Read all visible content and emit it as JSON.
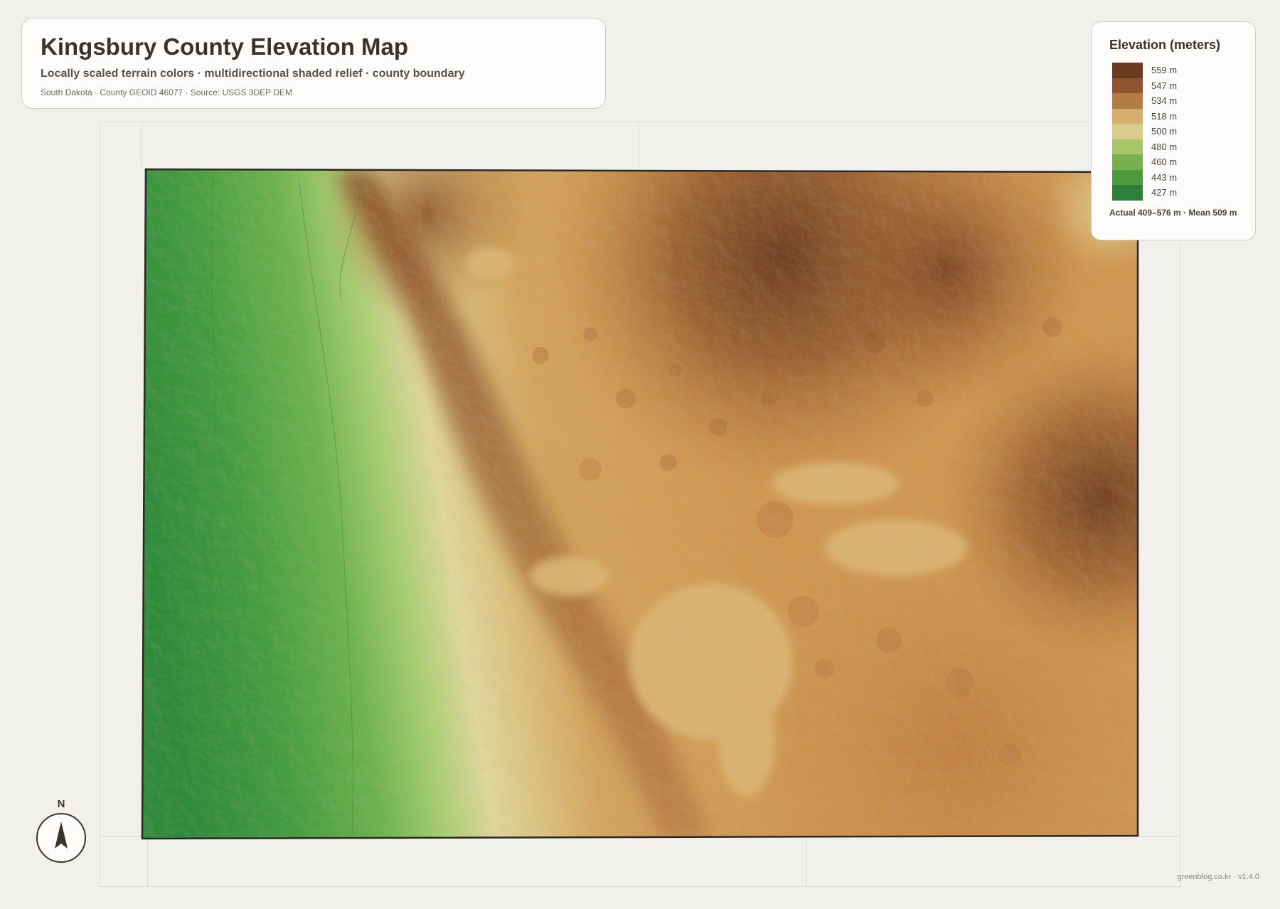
{
  "title_card": {
    "title": "Kingsbury County Elevation Map",
    "subtitle": "Locally scaled terrain colors · multidirectional shaded relief · county boundary",
    "source": "South Dakota · County GEOID 46077 · Source: USGS 3DEP DEM"
  },
  "legend": {
    "title": "Elevation (meters)",
    "items": [
      {
        "label": "559 m",
        "color": "#6a3a21"
      },
      {
        "label": "547 m",
        "color": "#8e5530"
      },
      {
        "label": "534 m",
        "color": "#b47c45"
      },
      {
        "label": "518 m",
        "color": "#d6ae6c"
      },
      {
        "label": "500 m",
        "color": "#d8cb8b"
      },
      {
        "label": "480 m",
        "color": "#a9c56a"
      },
      {
        "label": "460 m",
        "color": "#77b04d"
      },
      {
        "label": "443 m",
        "color": "#4c9a3e"
      },
      {
        "label": "427 m",
        "color": "#2d7f3c"
      }
    ],
    "stats": "Actual 409–576 m · Mean 509 m"
  },
  "north_arrow": {
    "label": "N"
  },
  "credit": "greenblog.co.kr · v1.4.0",
  "map": {
    "county": "Kingsbury County",
    "state": "South Dakota",
    "colors": {
      "low_dark_green": "#2f8a3a",
      "green": "#4ea33f",
      "light_green": "#a9cf70",
      "pale_yellow": "#e3d69a",
      "tan": "#d9aa62",
      "orange_brown": "#c48440",
      "brown": "#93592c",
      "dark_brown": "#6a3a20",
      "lake_tan": "#dcb46f",
      "boundary": "#2b2824"
    }
  }
}
